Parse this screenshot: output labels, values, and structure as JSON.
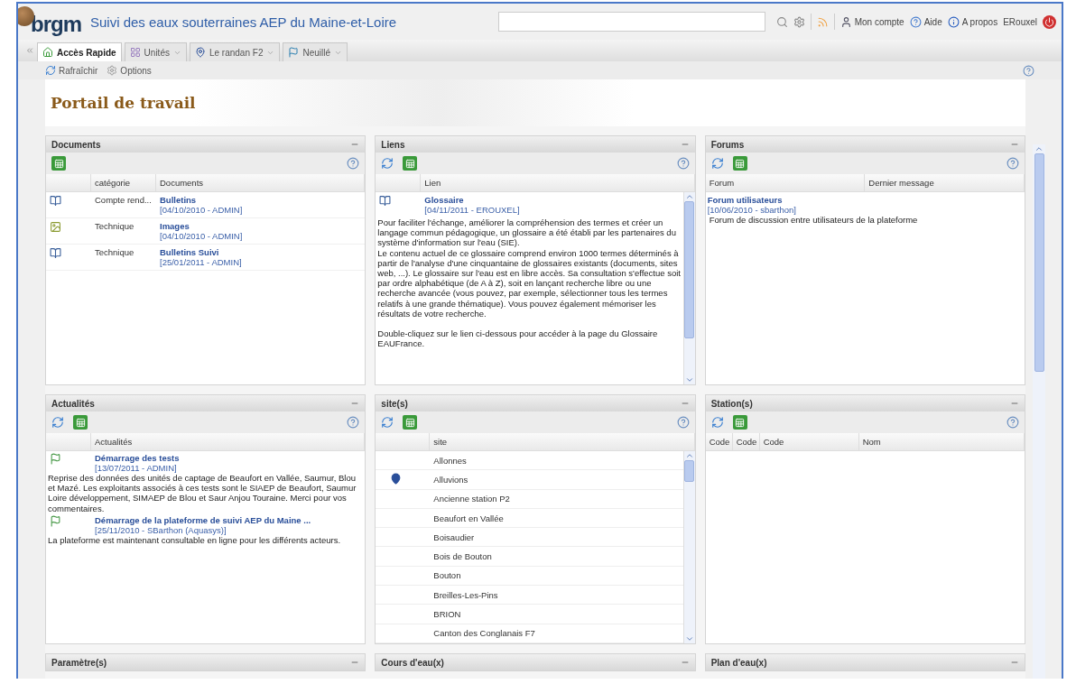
{
  "header": {
    "logo": "brgm",
    "title": "Suivi des eaux souterraines AEP du Maine-et-Loire",
    "links": [
      {
        "kind": "account",
        "label": "Mon compte"
      },
      {
        "kind": "help",
        "label": "Aide"
      },
      {
        "kind": "about",
        "label": "A propos"
      },
      {
        "kind": "user",
        "label": "ERouxel"
      }
    ]
  },
  "tabs": [
    {
      "label": "Accès Rapide",
      "kind": "home",
      "selected": true
    },
    {
      "label": "Unités",
      "kind": "units",
      "selected": false
    },
    {
      "label": "Le randan F2",
      "kind": "pin",
      "selected": false
    },
    {
      "label": "Neuillé",
      "kind": "flag",
      "selected": false
    }
  ],
  "toolbar": [
    {
      "kind": "refresh",
      "label": "Rafraîchir"
    },
    {
      "kind": "options",
      "label": "Options"
    }
  ],
  "portal_title": "Portail de travail",
  "panels": [
    {
      "title": "Documents",
      "kind": "documents",
      "refresh": false,
      "columns": [
        "catégorie",
        "Documents"
      ],
      "rows": [
        {
          "kind": "document",
          "category": "Compte rend...",
          "title": "Bulletins",
          "meta": "[04/10/2010 - ADMIN]"
        },
        {
          "kind": "image",
          "category": "Technique",
          "title": "Images",
          "meta": "[04/10/2010 - ADMIN]"
        },
        {
          "kind": "document",
          "category": "Technique",
          "title": "Bulletins Suivi",
          "meta": "[25/01/2011 - ADMIN]"
        }
      ]
    },
    {
      "title": "Liens",
      "kind": "links",
      "refresh": true,
      "columns": [
        "Lien"
      ],
      "rows": [
        {
          "title": "Glossaire",
          "meta": "[04/11/2011 - EROUXEL]",
          "paragraphs": [
            "Pour faciliter l'échange, améliorer la compréhension des termes et créer un langage commun pédagogique, un glossaire a été établi par les partenaires du système d'information sur l'eau (SIE).",
            "Le contenu actuel de ce glossaire comprend environ 1000 termes déterminés à partir de l'analyse d'une cinquantaine de glossaires existants (documents, sites web, ...). Le glossaire sur l'eau est en libre accès. Sa consultation s'effectue soit par ordre alphabétique (de A à Z), soit en lançant recherche libre ou une recherche avancée (vous pouvez, par exemple, sélectionner tous les termes relatifs à une grande thématique). Vous pouvez également mémoriser les résultats de votre recherche.",
            "Double-cliquez sur le lien ci-dessous pour accéder à la page du Glossaire EAUFrance."
          ]
        }
      ]
    },
    {
      "title": "Forums",
      "kind": "forums",
      "refresh": true,
      "columns": [
        "Forum",
        "Dernier message"
      ],
      "rows": [
        {
          "title": "Forum utilisateurs",
          "meta": "[10/06/2010 - sbarthon]",
          "description": "Forum de discussion entre utilisateurs de la plateforme"
        }
      ]
    },
    {
      "title": "Actualités",
      "kind": "news",
      "refresh": true,
      "columns": [
        "Actualités"
      ],
      "rows": [
        {
          "title": "Démarrage des tests",
          "meta": "[13/07/2011 - ADMIN]",
          "description": "Reprise des données des unités de captage de Beaufort en Vallée, Saumur, Blou et Mazé. Les exploitants associés à ces tests sont le SIAEP de Beaufort, Saumur Loire développement, SIMAEP de Blou et Saur Anjou Touraine. Merci pour vos commentaires."
        },
        {
          "title": "Démarrage de la plateforme de suivi AEP du Maine ...",
          "meta": "[25/11/2010 - SBarthon (Aquasys)]",
          "description": "La plateforme est maintenant consultable en ligne pour les différents acteurs."
        }
      ]
    },
    {
      "title": "site(s)",
      "kind": "sites",
      "refresh": true,
      "columns": [
        "site"
      ],
      "rows": [
        {
          "name": "Allonnes",
          "marked": false
        },
        {
          "name": "Alluvions",
          "marked": true
        },
        {
          "name": "Ancienne station P2",
          "marked": false
        },
        {
          "name": "Beaufort en Vallée",
          "marked": false
        },
        {
          "name": "Boisaudier",
          "marked": false
        },
        {
          "name": "Bois de Bouton",
          "marked": false
        },
        {
          "name": "Bouton",
          "marked": false
        },
        {
          "name": "Breilles-Les-Pins",
          "marked": false
        },
        {
          "name": "BRION",
          "marked": false
        },
        {
          "name": "Canton des Conglanais F7",
          "marked": false
        }
      ]
    },
    {
      "title": "Station(s)",
      "kind": "stations",
      "refresh": true,
      "columns": [
        "Code",
        "Code",
        "Code",
        "Nom"
      ]
    },
    {
      "title": "Paramètre(s)",
      "kind": "collapsed"
    },
    {
      "title": "Cours d'eau(x)",
      "kind": "collapsed"
    },
    {
      "title": "Plan d'eau(x)",
      "kind": "collapsed"
    }
  ]
}
